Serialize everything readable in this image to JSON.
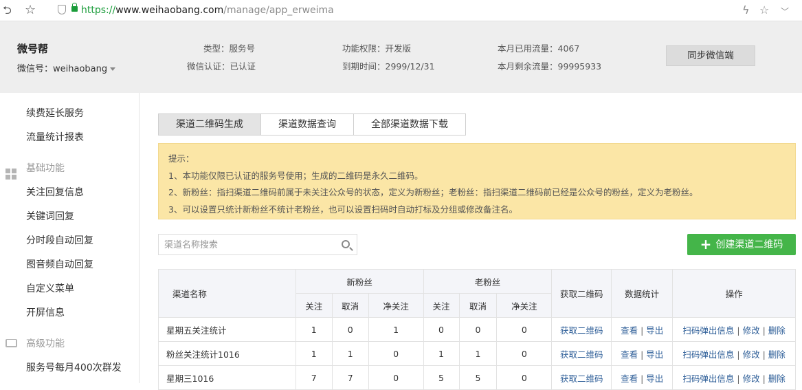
{
  "browser": {
    "url_scheme": "https://",
    "url_host": "www.weihaobang.com",
    "url_path": "/manage/app_erweima"
  },
  "account": {
    "name": "微号帮",
    "wechat_id": "微信号：weihaobang",
    "type": "类型：服务号",
    "certification": "微信认证：已认证",
    "permission": "功能权限：开发版",
    "expiry": "到期时间：2999/12/31",
    "used_traffic": "本月已用流量：4067",
    "remaining_traffic": "本月剩余流量：99995933",
    "sync_button": "同步微信端"
  },
  "sidebar": {
    "items_top": [
      "续费延长服务",
      "流量统计报表"
    ],
    "group_basic": "基础功能",
    "items_basic": [
      "关注回复信息",
      "关键词回复",
      "分时段自动回复",
      "图音频自动回复",
      "自定义菜单",
      "开屏信息"
    ],
    "group_advanced": "高级功能",
    "items_advanced": [
      "服务号每月400次群发"
    ]
  },
  "tabs": [
    "渠道二维码生成",
    "渠道数据查询",
    "全部渠道数据下载"
  ],
  "notice": {
    "title": "提示：",
    "lines": [
      "1、本功能仅限已认证的服务号使用；生成的二维码是永久二维码。",
      "2、新粉丝：指扫渠道二维码前属于未关注公众号的状态，定义为新粉丝；老粉丝：指扫渠道二维码前已经是公众号的粉丝，定义为老粉丝。",
      "3、可以设置只统计新粉丝不统计老粉丝，也可以设置扫码时自动打标及分组或修改备注名。"
    ]
  },
  "search": {
    "placeholder": "渠道名称搜索"
  },
  "create_button": "创建渠道二维码",
  "table": {
    "headers": {
      "name": "渠道名称",
      "new_fans": "新粉丝",
      "old_fans": "老粉丝",
      "get_qr": "获取二维码",
      "stats": "数据统计",
      "ops": "操作",
      "follow": "关注",
      "cancel": "取消",
      "net": "净关注"
    },
    "rows": [
      {
        "name": "星期五关注统计",
        "nf": "1",
        "nc": "0",
        "nn": "1",
        "of": "0",
        "oc": "0",
        "on": "0"
      },
      {
        "name": "粉丝关注统计1016",
        "nf": "1",
        "nc": "1",
        "nn": "0",
        "of": "1",
        "oc": "1",
        "on": "0"
      },
      {
        "name": "星期三1016",
        "nf": "7",
        "nc": "7",
        "nn": "0",
        "of": "5",
        "oc": "5",
        "on": "0"
      }
    ],
    "links": {
      "get_qr": "获取二维码",
      "view": "查看",
      "export": "导出",
      "popup": "扫码弹出信息",
      "edit": "修改",
      "delete": "删除",
      "sep": "|"
    }
  }
}
